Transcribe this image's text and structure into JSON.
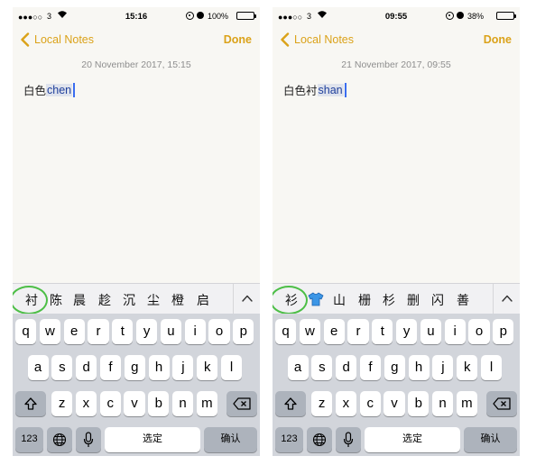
{
  "phones": [
    {
      "status": {
        "carrier": "3",
        "time": "15:16",
        "battery": "100%",
        "battery_level": 1.0
      },
      "nav": {
        "back": "Local Notes",
        "done": "Done"
      },
      "date": "20 November 2017, 15:15",
      "note": {
        "text": "白色",
        "marked": "chen"
      },
      "candidates": [
        "衬",
        "陈",
        "晨",
        "趁",
        "沉",
        "尘",
        "橙",
        "启"
      ]
    },
    {
      "status": {
        "carrier": "3",
        "time": "09:55",
        "battery": "38%",
        "battery_level": 0.38
      },
      "nav": {
        "back": "Local Notes",
        "done": "Done"
      },
      "date": "21 November 2017, 09:55",
      "note": {
        "text": "白色衬",
        "marked": "shan"
      },
      "candidates": [
        "衫",
        "👕",
        "山",
        "栅",
        "杉",
        "删",
        "闪",
        "善"
      ]
    }
  ],
  "keyboard": {
    "row1": [
      "q",
      "w",
      "e",
      "r",
      "t",
      "y",
      "u",
      "i",
      "o",
      "p"
    ],
    "row2": [
      "a",
      "s",
      "d",
      "f",
      "g",
      "h",
      "j",
      "k",
      "l"
    ],
    "row3": [
      "z",
      "x",
      "c",
      "v",
      "b",
      "n",
      "m"
    ],
    "numbers_key": "123",
    "space_key": "选定",
    "return_key": "确认",
    "icons": {
      "shift": "shift-icon",
      "delete": "delete-icon",
      "globe": "globe-icon",
      "mic": "microphone-icon",
      "expand": "chevron-up-icon",
      "back": "chevron-left-icon"
    }
  },
  "colors": {
    "accent": "#dba219",
    "highlight": "#4cbe46",
    "marked_bg": "#dfe3ec",
    "caret": "#3a6df0",
    "keyboard_bg": "#d2d5db"
  }
}
